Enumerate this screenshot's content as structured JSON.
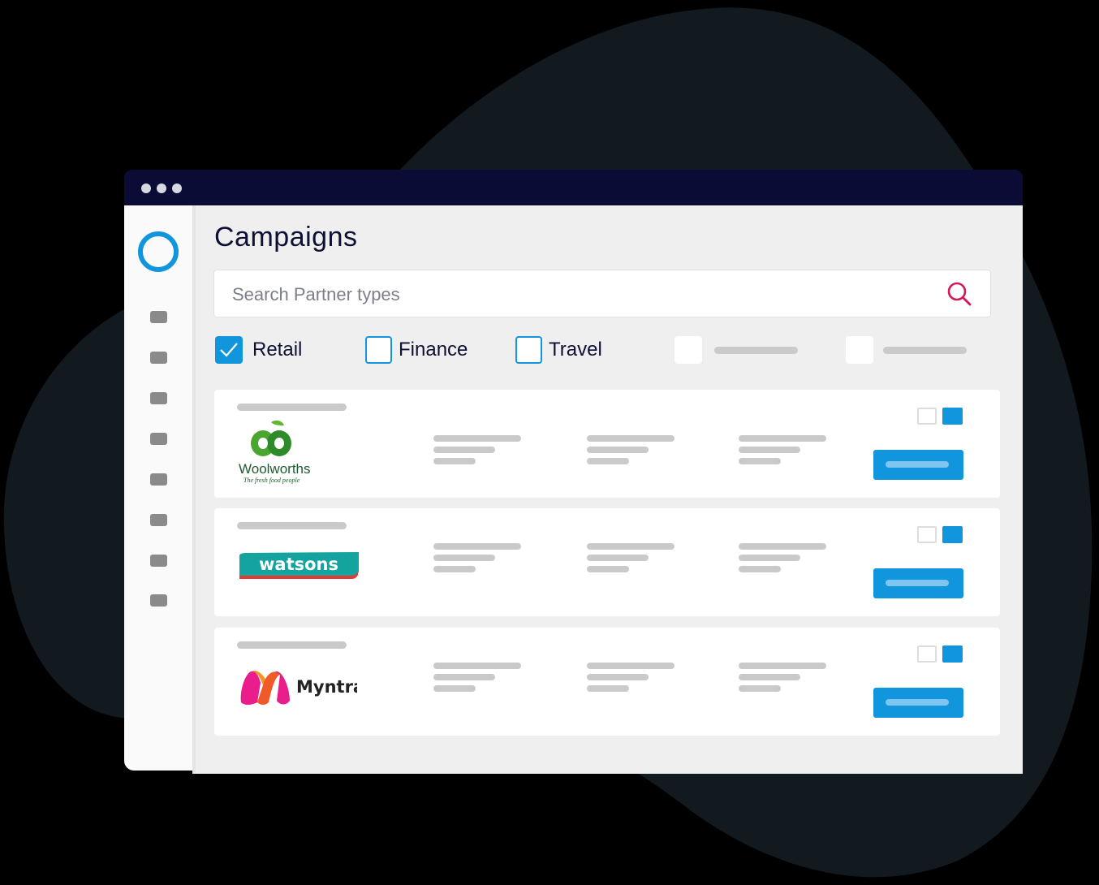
{
  "window": {
    "title_dots": 3
  },
  "sidebar": {
    "logo_icon": "ring-logo-icon",
    "items": [
      {
        "icon": "nav-placeholder-icon"
      },
      {
        "icon": "nav-placeholder-icon"
      },
      {
        "icon": "nav-placeholder-icon"
      },
      {
        "icon": "nav-placeholder-icon"
      },
      {
        "icon": "nav-placeholder-icon"
      },
      {
        "icon": "nav-placeholder-icon"
      },
      {
        "icon": "nav-placeholder-icon"
      },
      {
        "icon": "nav-placeholder-icon"
      }
    ]
  },
  "main": {
    "title": "Campaigns",
    "search": {
      "value": "",
      "placeholder": "Search Partner types",
      "icon": "search-icon"
    },
    "filters": [
      {
        "label": "Retail",
        "checked": true
      },
      {
        "label": "Finance",
        "checked": false
      },
      {
        "label": "Travel",
        "checked": false
      },
      {
        "label": "",
        "checked": false,
        "placeholder": true
      },
      {
        "label": "",
        "checked": false,
        "placeholder": true
      }
    ],
    "campaigns": [
      {
        "brand": "Woolworths",
        "tagline": "The fresh food people"
      },
      {
        "brand": "watsons"
      },
      {
        "brand": "Myntra"
      }
    ]
  },
  "colors": {
    "accent": "#1195dd",
    "titlebar": "#0b0c36",
    "search_icon": "#d2185a",
    "background_blob": "#121a20"
  }
}
